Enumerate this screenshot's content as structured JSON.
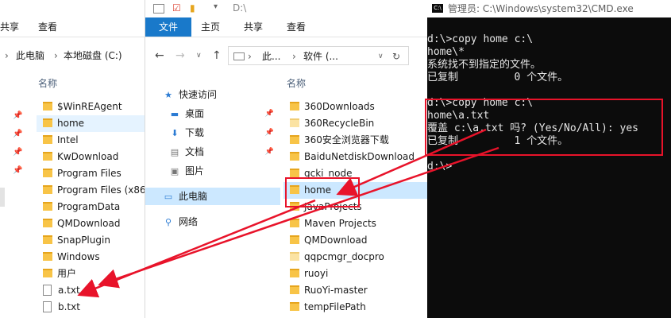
{
  "left": {
    "ribbon_tabs": [
      "共享",
      "查看"
    ],
    "address": [
      "此电脑",
      "本地磁盘 (C:)"
    ],
    "column_header": "名称",
    "items": [
      {
        "name": "$WinREAgent",
        "type": "folder"
      },
      {
        "name": "home",
        "type": "folder"
      },
      {
        "name": "Intel",
        "type": "folder"
      },
      {
        "name": "KwDownload",
        "type": "folder"
      },
      {
        "name": "Program Files",
        "type": "folder"
      },
      {
        "name": "Program Files (x86)",
        "type": "folder"
      },
      {
        "name": "ProgramData",
        "type": "folder"
      },
      {
        "name": "QMDownload",
        "type": "folder"
      },
      {
        "name": "SnapPlugin",
        "type": "folder"
      },
      {
        "name": "Windows",
        "type": "folder"
      },
      {
        "name": "用户",
        "type": "folder"
      },
      {
        "name": "a.txt",
        "type": "file"
      },
      {
        "name": "b.txt",
        "type": "file"
      }
    ]
  },
  "middle": {
    "title_path": "D:\\",
    "ribbon_tabs": [
      "文件",
      "主页",
      "共享",
      "查看"
    ],
    "address": [
      "此...",
      "软件 (..."
    ],
    "column_header": "名称",
    "nav": [
      {
        "label": "快速访问",
        "icon": "star-icon"
      },
      {
        "label": "桌面",
        "icon": "desktop-icon"
      },
      {
        "label": "下载",
        "icon": "download-icon"
      },
      {
        "label": "文档",
        "icon": "document-icon"
      },
      {
        "label": "图片",
        "icon": "picture-icon"
      },
      {
        "label": "此电脑",
        "icon": "computer-icon"
      },
      {
        "label": "网络",
        "icon": "network-icon"
      }
    ],
    "items": [
      {
        "name": "360Downloads",
        "ghost": false
      },
      {
        "name": "360RecycleBin",
        "ghost": true
      },
      {
        "name": "360安全浏览器下载",
        "ghost": false
      },
      {
        "name": "BaiduNetdiskDownload",
        "ghost": false
      },
      {
        "name": "gcki_node",
        "ghost": false
      },
      {
        "name": "home",
        "ghost": false
      },
      {
        "name": "JavaProjects",
        "ghost": false
      },
      {
        "name": "Maven Projects",
        "ghost": false
      },
      {
        "name": "QMDownload",
        "ghost": false
      },
      {
        "name": "qqpcmgr_docpro",
        "ghost": true
      },
      {
        "name": "ruoyi",
        "ghost": false
      },
      {
        "name": "RuoYi-master",
        "ghost": false
      },
      {
        "name": "tempFilePath",
        "ghost": false
      }
    ]
  },
  "cmd": {
    "title": "管理员: C:\\Windows\\system32\\CMD.exe",
    "lines": [
      "d:\\>copy home c:\\",
      "home\\*",
      "系统找不到指定的文件。",
      "已复制         0 个文件。",
      "",
      "d:\\>copy home c:\\",
      "home\\a.txt",
      "覆盖 c:\\a.txt 吗? (Yes/No/All): yes",
      "已复制         1 个文件。",
      "",
      "d:\\>"
    ]
  },
  "colors": {
    "annotation_red": "#e8132a",
    "file_tab_blue": "#1979ca",
    "folder_yellow": "#f8c447"
  }
}
